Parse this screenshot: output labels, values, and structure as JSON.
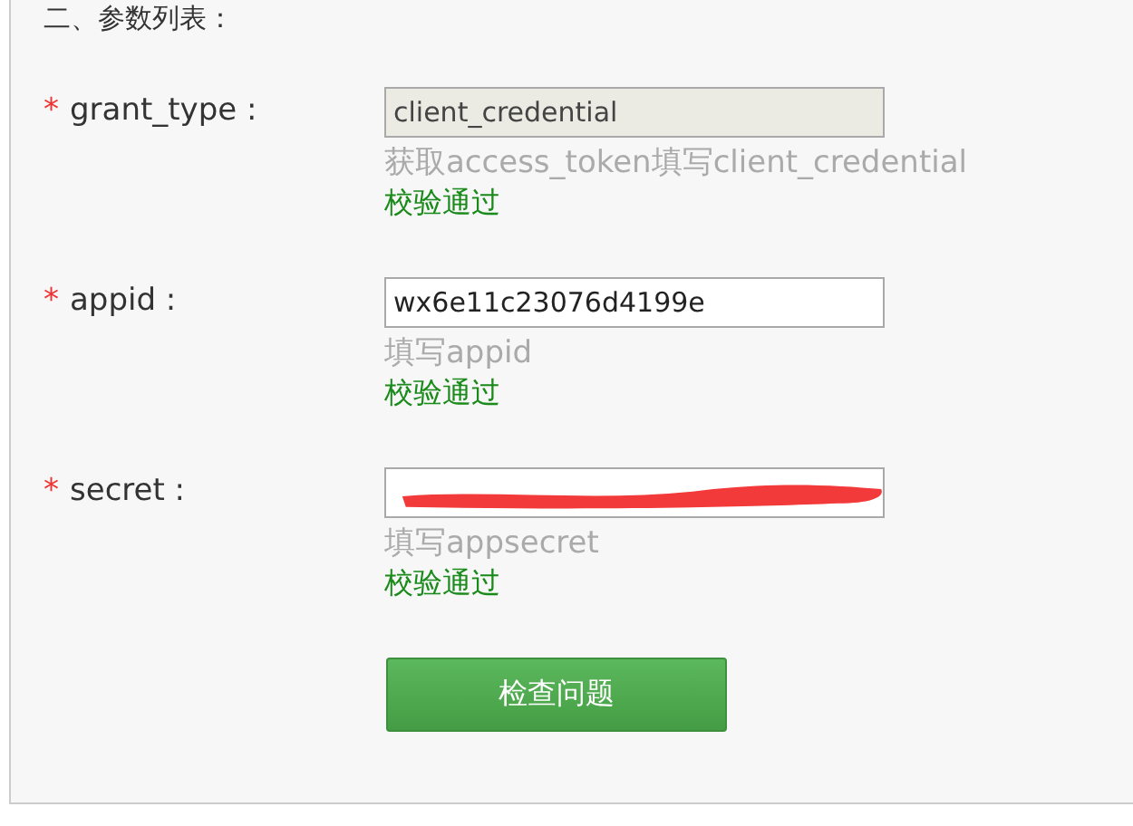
{
  "heading": "二、参数列表：",
  "fields": [
    {
      "mark": "*",
      "label": "grant_type :",
      "value": "client_credential",
      "disabled": true,
      "hint": "获取access_token填写client_credential",
      "status": "校验通过"
    },
    {
      "mark": "*",
      "label": "appid :",
      "value": "wx6e11c23076d4199e",
      "disabled": false,
      "hint": "填写appid",
      "status": "校验通过"
    },
    {
      "mark": "*",
      "label": "secret :",
      "disabled": false,
      "redacted": true,
      "hint": "填写appsecret",
      "status": "校验通过"
    }
  ],
  "button": "检查问题"
}
